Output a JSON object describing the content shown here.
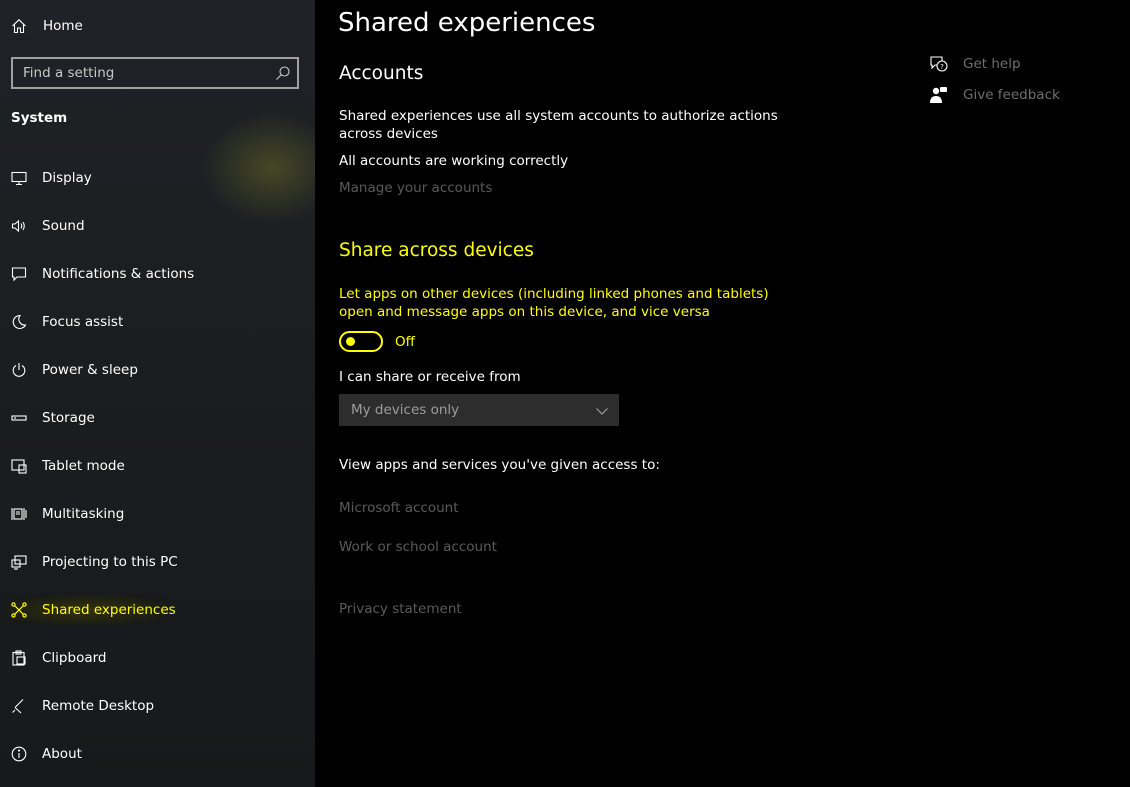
{
  "sidebar": {
    "home_label": "Home",
    "search_placeholder": "Find a setting",
    "section_title": "System",
    "items": [
      {
        "label": "Display",
        "icon": "display-icon"
      },
      {
        "label": "Sound",
        "icon": "speaker-icon"
      },
      {
        "label": "Notifications & actions",
        "icon": "message-icon"
      },
      {
        "label": "Focus assist",
        "icon": "moon-icon"
      },
      {
        "label": "Power & sleep",
        "icon": "power-icon"
      },
      {
        "label": "Storage",
        "icon": "storage-icon"
      },
      {
        "label": "Tablet mode",
        "icon": "tablet-mode-icon"
      },
      {
        "label": "Multitasking",
        "icon": "multitasking-icon"
      },
      {
        "label": "Projecting to this PC",
        "icon": "projecting-icon"
      },
      {
        "label": "Shared experiences",
        "icon": "shared-experiences-icon",
        "active": true
      },
      {
        "label": "Clipboard",
        "icon": "clipboard-icon"
      },
      {
        "label": "Remote Desktop",
        "icon": "remote-desktop-icon"
      },
      {
        "label": "About",
        "icon": "info-icon"
      }
    ]
  },
  "main": {
    "title": "Shared experiences",
    "accounts": {
      "heading": "Accounts",
      "description": "Shared experiences use all system accounts to authorize actions across devices",
      "status": "All accounts are working correctly",
      "manage_link": "Manage your accounts"
    },
    "share": {
      "heading": "Share across devices",
      "description": "Let apps on other devices (including linked phones and tablets) open and message apps on this device, and vice versa",
      "toggle_state": "Off",
      "share_label": "I can share or receive from",
      "dropdown_value": "My devices only",
      "access_label": "View apps and services you've given access to:",
      "microsoft_account_link": "Microsoft account",
      "work_account_link": "Work or school account",
      "privacy_link": "Privacy statement"
    },
    "aside": {
      "get_help": "Get help",
      "give_feedback": "Give feedback"
    }
  },
  "colors": {
    "highlight": "#ffff00",
    "disabled_text": "#5a5a5a",
    "background": "#000000",
    "sidebar_background": "#1c1f22"
  }
}
